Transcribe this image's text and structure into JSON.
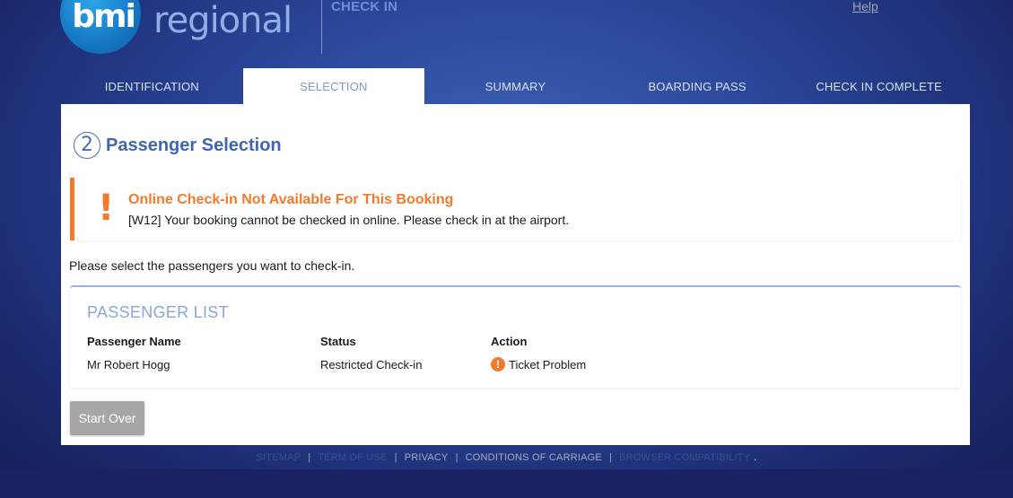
{
  "header": {
    "logo_bmi": "bmi",
    "logo_regional": "regional",
    "title": "CHECK IN",
    "help": "Help"
  },
  "tabs": [
    {
      "label": "IDENTIFICATION",
      "active": false
    },
    {
      "label": "SELECTION",
      "active": true
    },
    {
      "label": "SUMMARY",
      "active": false
    },
    {
      "label": "BOARDING PASS",
      "active": false
    },
    {
      "label": "CHECK IN COMPLETE",
      "active": false
    }
  ],
  "page": {
    "step_number": "2",
    "title": "Passenger Selection"
  },
  "alert": {
    "icon": "exclamation-icon",
    "title": "Online Check-in Not Available For This Booking",
    "message": "[W12] Your booking cannot be checked in online. Please check in at the airport.",
    "color": "#f27a2b"
  },
  "instruction": "Please select the passengers you want to check-in.",
  "passenger_list": {
    "title": "PASSENGER LIST",
    "columns": [
      "Passenger Name",
      "Status",
      "Action"
    ],
    "rows": [
      {
        "name": "Mr Robert Hogg",
        "status": "Restricted Check-in",
        "action": "Ticket Problem",
        "action_icon": "warning-icon"
      }
    ]
  },
  "buttons": {
    "start_over": "Start Over"
  },
  "footer": {
    "links": [
      "SITEMAP",
      "TERM OF USE",
      "PRIVACY",
      "CONDITIONS OF CARRIAGE",
      "BROWSER COMPATIBILITY"
    ],
    "separator": "|",
    "trailing": "."
  },
  "colors": {
    "brand_blue": "#3f66b1",
    "accent_orange": "#f27a2b",
    "button_gray": "#a6a6a6"
  }
}
